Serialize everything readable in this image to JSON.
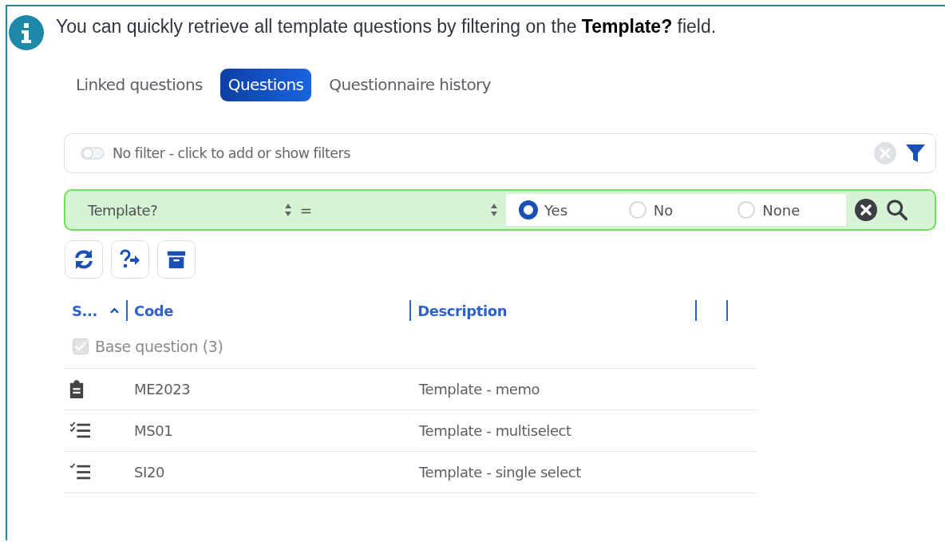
{
  "info": {
    "text": "You can quickly retrieve all template questions by filtering on the **Template?** field."
  },
  "tabs": [
    {
      "label": "Linked questions",
      "selected": false
    },
    {
      "label": "Questions",
      "selected": true
    },
    {
      "label": "Questionnaire history",
      "selected": false
    }
  ],
  "filter_bar": {
    "text": "No filter - click to add or show filters"
  },
  "filter_row": {
    "field": "Template?",
    "operator": "=",
    "options": [
      {
        "label": "Yes",
        "selected": true
      },
      {
        "label": "No",
        "selected": false
      },
      {
        "label": "None",
        "selected": false
      }
    ]
  },
  "toolbar": [
    {
      "kind": "refresh"
    },
    {
      "kind": "question-arrow"
    },
    {
      "kind": "archive"
    }
  ],
  "table": {
    "columns": [
      {
        "label": "S...",
        "sorted": true
      },
      {
        "label": "Code",
        "sorted": false
      },
      {
        "label": "Description",
        "sorted": false
      }
    ],
    "group": {
      "label": "Base question (3)",
      "checked": true
    },
    "rows": [
      {
        "kind": "memo",
        "code": "ME2023",
        "description": "Template - memo"
      },
      {
        "kind": "multiselect",
        "code": "MS01",
        "description": "Template - multiselect"
      },
      {
        "kind": "singleselect",
        "code": "SI20",
        "description": "Template - single select"
      }
    ]
  }
}
